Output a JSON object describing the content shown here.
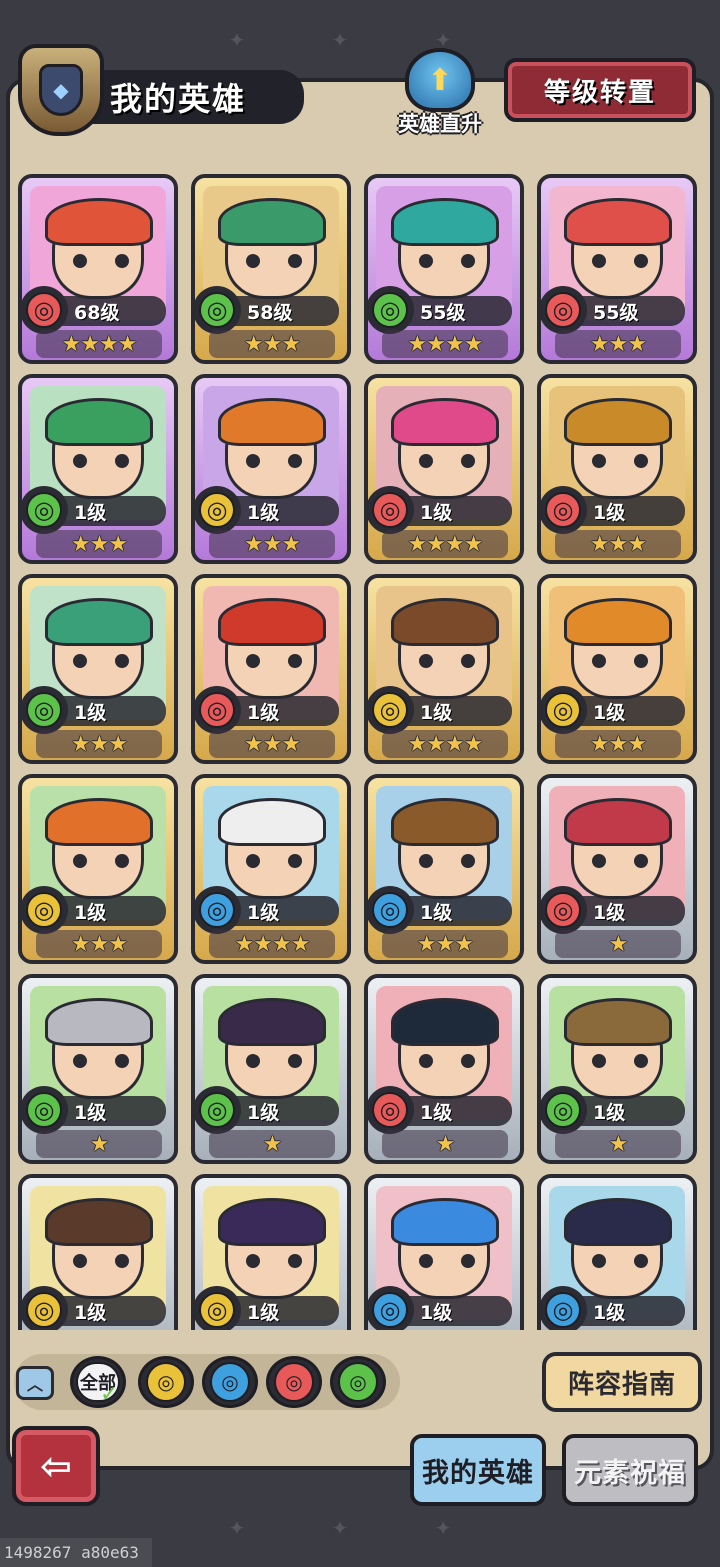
{
  "header": {
    "title": "我的英雄",
    "helmet_icon": "helmet-icon",
    "direct_upgrade_label": "英雄直升",
    "level_reset_label": "等级转置"
  },
  "element_colors": {
    "fire": "#e85a5a",
    "wind": "#5cc24a",
    "earth": "#e9c23a",
    "water": "#3fa0e0"
  },
  "heroes": [
    {
      "level": "68级",
      "element": "fire",
      "stars": "★★★★",
      "frame": "purple",
      "hair": "#e0553a",
      "bg": "#f0a6d8"
    },
    {
      "level": "58级",
      "element": "wind",
      "stars": "★★★",
      "frame": "gold",
      "hair": "#3a9a6a",
      "bg": "#e8c98a"
    },
    {
      "level": "55级",
      "element": "wind",
      "stars": "★★★★",
      "frame": "purple",
      "hair": "#2fa8a0",
      "bg": "#d7a0e6"
    },
    {
      "level": "55级",
      "element": "fire",
      "stars": "★★★",
      "frame": "purple",
      "hair": "#e0504a",
      "bg": "#f2b6cf"
    },
    {
      "level": "1级",
      "element": "wind",
      "stars": "★★★",
      "frame": "purple",
      "hair": "#3aa060",
      "bg": "#b9e0c0"
    },
    {
      "level": "1级",
      "element": "earth",
      "stars": "★★★",
      "frame": "purple",
      "hair": "#e07a2a",
      "bg": "#c9a6e8"
    },
    {
      "level": "1级",
      "element": "fire",
      "stars": "★★★★",
      "frame": "gold",
      "hair": "#e04a8a",
      "bg": "#e6b0b8"
    },
    {
      "level": "1级",
      "element": "fire",
      "stars": "★★★",
      "frame": "gold",
      "hair": "#c98a2a",
      "bg": "#e6c27a"
    },
    {
      "level": "1级",
      "element": "wind",
      "stars": "★★★",
      "frame": "gold",
      "hair": "#3aa07a",
      "bg": "#bfe2c8"
    },
    {
      "level": "1级",
      "element": "fire",
      "stars": "★★★",
      "frame": "gold",
      "hair": "#d03a2a",
      "bg": "#f0b8b0"
    },
    {
      "level": "1级",
      "element": "earth",
      "stars": "★★★★",
      "frame": "gold",
      "hair": "#7a4a2a",
      "bg": "#e8c48a"
    },
    {
      "level": "1级",
      "element": "earth",
      "stars": "★★★",
      "frame": "gold",
      "hair": "#e08a2a",
      "bg": "#f0c078"
    },
    {
      "level": "1级",
      "element": "earth",
      "stars": "★★★",
      "frame": "gold",
      "hair": "#e0702a",
      "bg": "#b8e0a8"
    },
    {
      "level": "1级",
      "element": "water",
      "stars": "★★★★",
      "frame": "gold",
      "hair": "#eeeeee",
      "bg": "#a8d8ea"
    },
    {
      "level": "1级",
      "element": "water",
      "stars": "★★★",
      "frame": "gold",
      "hair": "#8a5a2a",
      "bg": "#a8d0e8"
    },
    {
      "level": "1级",
      "element": "fire",
      "stars": "★",
      "frame": "silver",
      "hair": "#c03a4a",
      "bg": "#f0b0b8"
    },
    {
      "level": "1级",
      "element": "wind",
      "stars": "★",
      "frame": "silver",
      "hair": "#b8b8c0",
      "bg": "#b8e0a0"
    },
    {
      "level": "1级",
      "element": "wind",
      "stars": "★",
      "frame": "silver",
      "hair": "#3a2a4a",
      "bg": "#b8e0a0"
    },
    {
      "level": "1级",
      "element": "fire",
      "stars": "★",
      "frame": "silver",
      "hair": "#1e2a3a",
      "bg": "#f0b0b8"
    },
    {
      "level": "1级",
      "element": "wind",
      "stars": "★",
      "frame": "silver",
      "hair": "#8a6a3a",
      "bg": "#b8e0a0"
    },
    {
      "level": "1级",
      "element": "earth",
      "stars": "",
      "frame": "silver",
      "hair": "#5a3a2a",
      "bg": "#f0e2a0"
    },
    {
      "level": "1级",
      "element": "earth",
      "stars": "",
      "frame": "silver",
      "hair": "#3a2a5a",
      "bg": "#f0e2a0"
    },
    {
      "level": "1级",
      "element": "water",
      "stars": "",
      "frame": "silver",
      "hair": "#3a8ae0",
      "bg": "#f0c0c8"
    },
    {
      "level": "1级",
      "element": "water",
      "stars": "",
      "frame": "silver",
      "hair": "#2a2a4a",
      "bg": "#a8d8ea"
    }
  ],
  "filter": {
    "collapse_icon": "chevron-up-icon",
    "all_label": "全部",
    "elements": [
      "earth",
      "water",
      "fire",
      "wind"
    ]
  },
  "lineup_guide_label": "阵容指南",
  "tabs": {
    "my_heroes": "我的英雄",
    "element_blessing": "元素祝福"
  },
  "footer_id": "1498267 a80e63"
}
